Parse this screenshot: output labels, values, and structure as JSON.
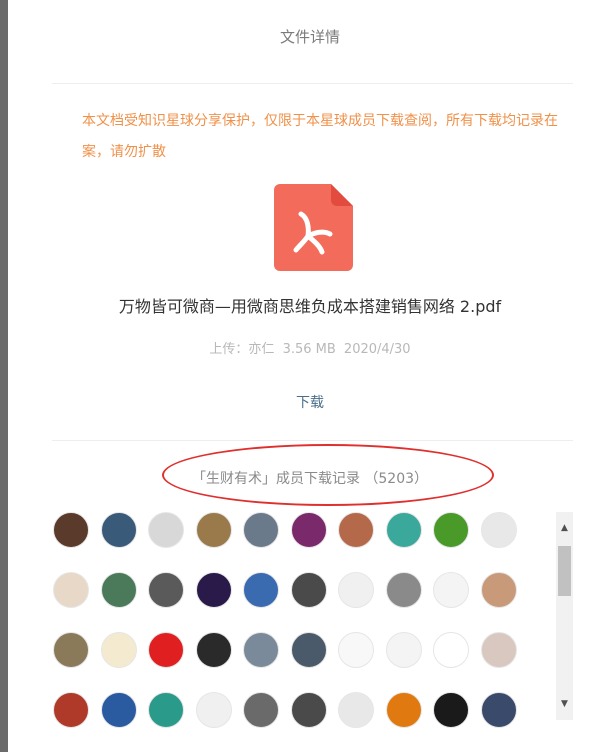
{
  "dialog": {
    "title": "文件详情",
    "notice": "本文档受知识星球分享保护，仅限于本星球成员下载查阅，所有下载均记录在案，请勿扩散",
    "file": {
      "name": "万物皆可微商—用微商思维负成本搭建销售网络 2.pdf",
      "uploader": "上传：亦仁",
      "size": "3.56 MB",
      "date": "2020/4/30"
    },
    "download_label": "下载",
    "records_title": "「生财有术」成员下载记录 （5203）"
  },
  "colors": {
    "notice": "#f0914a",
    "pdf_icon": "#f26b5b",
    "highlight": "#e0302e",
    "link": "#4a6e8a"
  },
  "scrollbar": {
    "up_icon": "caret-up-icon",
    "down_icon": "caret-down-icon"
  },
  "avatars": [
    [
      "#5a3a2a",
      "#3a5a7a",
      "#d8d8d8",
      "#9a7a4a",
      "#6a7a8a",
      "#7a2a6a",
      "#b46a4a",
      "#3aa89a",
      "#4a9a2a",
      "#e8e8e8"
    ],
    [
      "#e8d8c8",
      "#4a7a5a",
      "#5a5a5a",
      "#2a1a4a",
      "#3a6ab0",
      "#4a4a4a",
      "#f0f0f0",
      "#8a8a8a",
      "#f4f4f4",
      "#c89a7a"
    ],
    [
      "#8a7a5a",
      "#f4ead0",
      "#e02020",
      "#2a2a2a",
      "#7a8a9a",
      "#4a5a6a",
      "#f8f8f8",
      "#f4f4f4",
      "#ffffff",
      "#d8c8c0"
    ],
    [
      "#b03a2a",
      "#2a5aa0",
      "#2a9a8a",
      "#f0f0f0",
      "#6a6a6a",
      "#4a4a4a",
      "#e8e8e8",
      "#e07a10",
      "#1a1a1a",
      "#3a4a6a"
    ]
  ]
}
